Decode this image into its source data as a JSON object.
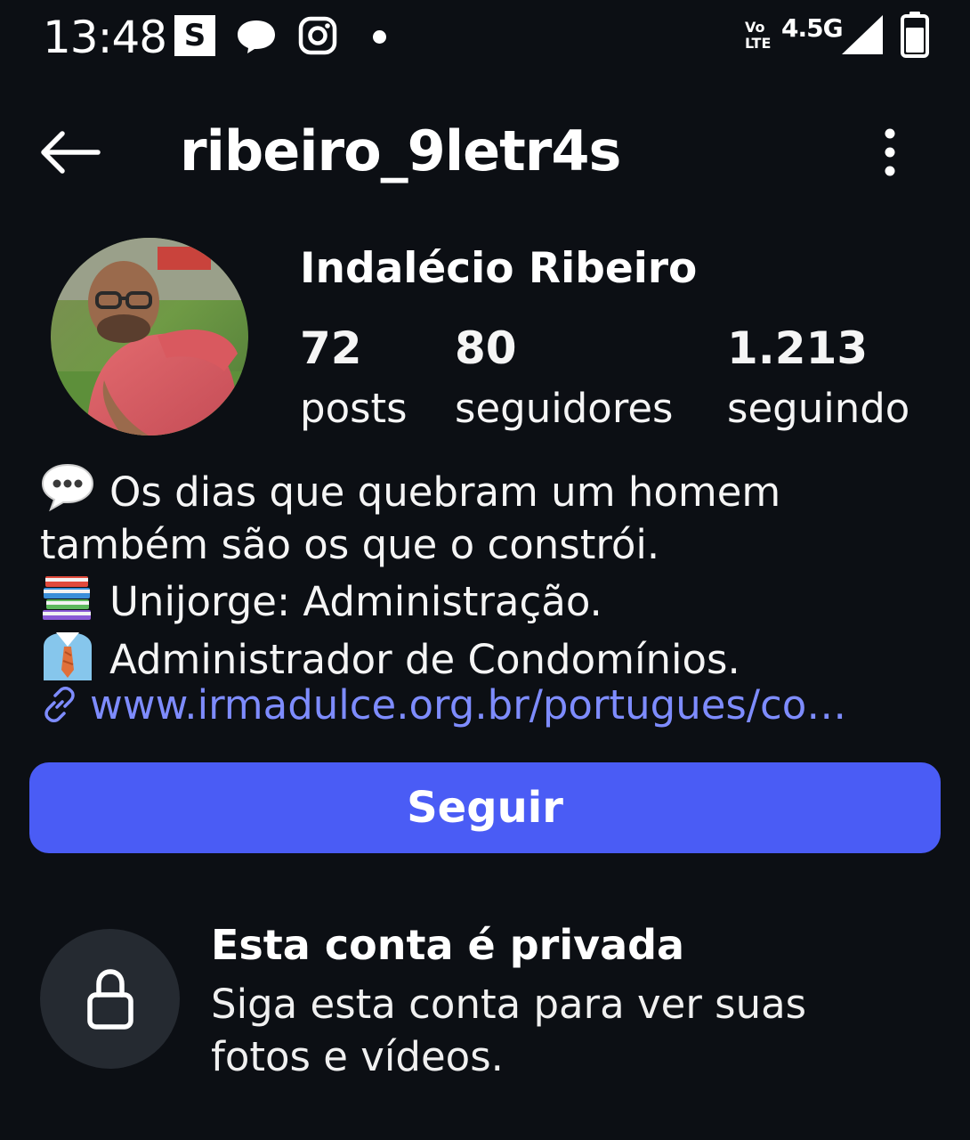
{
  "status_bar": {
    "time": "13:48",
    "s_icon": "S",
    "volte_top": "Vo",
    "volte_bottom": "LTE",
    "network": "4.5G",
    "icons": [
      "s-app-icon",
      "chat-bubble-icon",
      "instagram-icon",
      "notification-dot",
      "volte-icon",
      "signal-icon",
      "battery-icon"
    ]
  },
  "header": {
    "username": "ribeiro_9letr4s",
    "back_icon": "arrow-left-icon",
    "more_icon": "more-vertical-icon"
  },
  "profile": {
    "display_name": "Indalécio Ribeiro",
    "stats": [
      {
        "value": "72",
        "label": "posts"
      },
      {
        "value": "80",
        "label": "seguidores"
      },
      {
        "value": "1.213",
        "label": "seguindo"
      }
    ]
  },
  "bio": {
    "line1": "Os dias que quebram um homem",
    "line2": "também são os que o constrói.",
    "line3": "Unijorge: Administração.",
    "line4": "Administrador de Condomínios.",
    "link": "www.irmadulce.org.br/portugues/co…",
    "emoji_icons": [
      "speech-balloon-emoji",
      "books-emoji",
      "man-in-suit-emoji",
      "link-icon"
    ]
  },
  "follow_button": {
    "label": "Seguir"
  },
  "private_notice": {
    "title": "Esta conta é privada",
    "description_line1": "Siga esta conta para ver suas",
    "description_line2": "fotos e vídeos.",
    "icon": "lock-icon"
  },
  "colors": {
    "background": "#0c0f14",
    "accent": "#4a5cf5",
    "link": "#7e8cff",
    "lock_circle": "#252a31"
  }
}
